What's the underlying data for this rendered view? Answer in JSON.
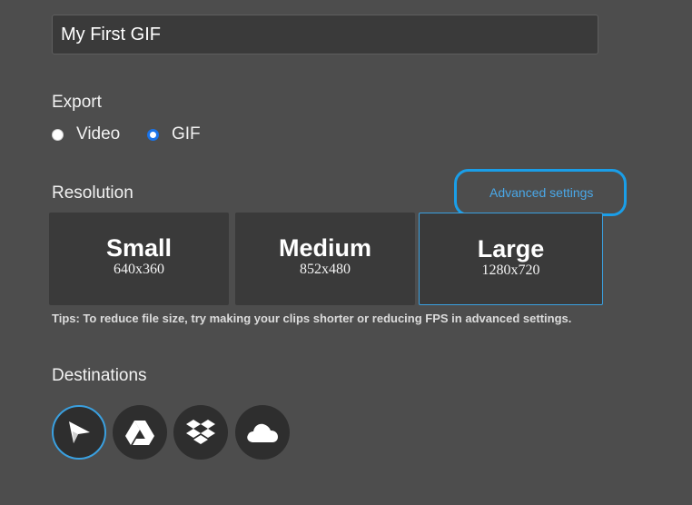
{
  "title_field": {
    "value": "My First GIF"
  },
  "export": {
    "label": "Export",
    "options": [
      {
        "label": "Video",
        "selected": false
      },
      {
        "label": "GIF",
        "selected": true
      }
    ]
  },
  "resolution": {
    "label": "Resolution",
    "advanced_link": "Advanced settings",
    "options": [
      {
        "name": "Small",
        "dims": "640x360",
        "selected": false
      },
      {
        "name": "Medium",
        "dims": "852x480",
        "selected": false
      },
      {
        "name": "Large",
        "dims": "1280x720",
        "selected": true
      }
    ],
    "tips": "Tips: To reduce file size, try making your clips shorter or reducing FPS in advanced settings."
  },
  "destinations": {
    "label": "Destinations",
    "items": [
      {
        "icon": "send-arrow-icon",
        "selected": true
      },
      {
        "icon": "google-drive-icon",
        "selected": false
      },
      {
        "icon": "dropbox-icon",
        "selected": false
      },
      {
        "icon": "cloud-icon",
        "selected": false
      }
    ]
  },
  "colors": {
    "background": "#4d4d4d",
    "card": "#3a3a3a",
    "accent": "#3aa0e0",
    "link": "#4aa8e8",
    "radio_selected": "#1a73e8"
  }
}
